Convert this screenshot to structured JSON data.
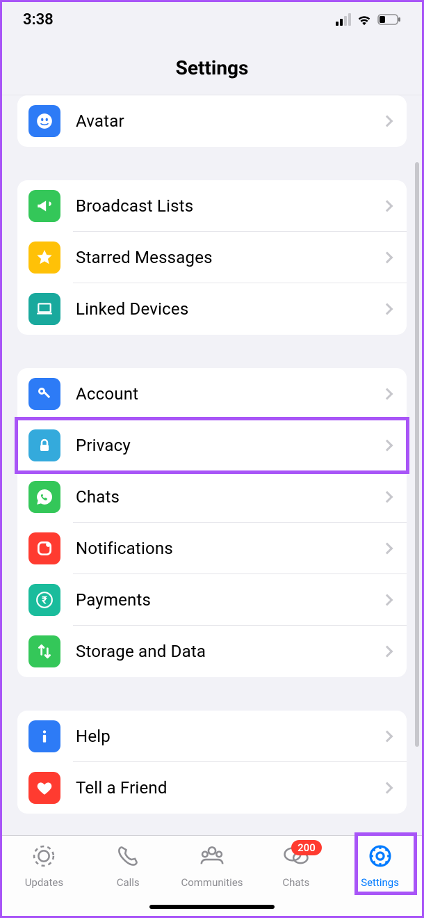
{
  "status": {
    "time": "3:38"
  },
  "header": {
    "title": "Settings"
  },
  "sections": [
    {
      "items": [
        {
          "label": "Avatar",
          "icon": "avatar-icon",
          "color": "bg-blue"
        }
      ]
    },
    {
      "items": [
        {
          "label": "Broadcast Lists",
          "icon": "megaphone-icon",
          "color": "bg-green"
        },
        {
          "label": "Starred Messages",
          "icon": "star-icon",
          "color": "bg-yellow"
        },
        {
          "label": "Linked Devices",
          "icon": "laptop-icon",
          "color": "bg-teal"
        }
      ]
    },
    {
      "items": [
        {
          "label": "Account",
          "icon": "key-icon",
          "color": "bg-blue"
        },
        {
          "label": "Privacy",
          "icon": "lock-icon",
          "color": "bg-sky",
          "highlighted": true
        },
        {
          "label": "Chats",
          "icon": "whatsapp-icon",
          "color": "bg-green"
        },
        {
          "label": "Notifications",
          "icon": "notification-icon",
          "color": "bg-red"
        },
        {
          "label": "Payments",
          "icon": "rupee-icon",
          "color": "bg-teal2"
        },
        {
          "label": "Storage and Data",
          "icon": "arrows-icon",
          "color": "bg-green"
        }
      ]
    },
    {
      "items": [
        {
          "label": "Help",
          "icon": "info-icon",
          "color": "bg-blue"
        },
        {
          "label": "Tell a Friend",
          "icon": "heart-icon",
          "color": "bg-red"
        }
      ]
    }
  ],
  "tabs": [
    {
      "label": "Updates",
      "icon": "updates-icon"
    },
    {
      "label": "Calls",
      "icon": "calls-icon"
    },
    {
      "label": "Communities",
      "icon": "communities-icon"
    },
    {
      "label": "Chats",
      "icon": "chats-icon",
      "badge": "200"
    },
    {
      "label": "Settings",
      "icon": "settings-icon",
      "active": true,
      "highlighted": true
    }
  ]
}
